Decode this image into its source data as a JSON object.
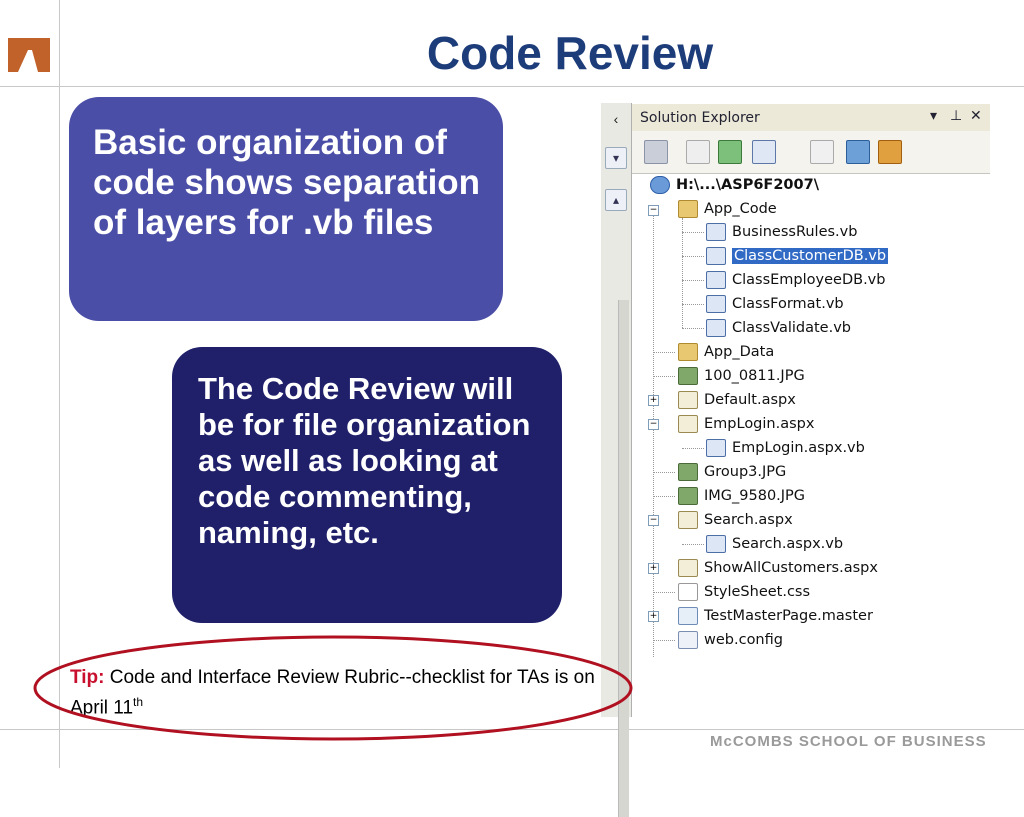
{
  "slide": {
    "title": "Code Review",
    "box1_text": "Basic organization of code shows separation of layers for .vb files",
    "box2_text": "The Code Review will be for file organization as well as looking at code commenting, naming, etc.",
    "tip_label": "Tip:",
    "tip_text": " Code and Interface Review Rubric--checklist for TAs is on April 11",
    "tip_sup": "th",
    "footer": "McCOMBS SCHOOL OF BUSINESS"
  },
  "solution_explorer": {
    "title": "Solution Explorer",
    "controls": [
      "▾",
      "⊥",
      "✕"
    ],
    "root": "H:\\...\\ASP6F2007\\",
    "items": [
      {
        "label": "App_Code",
        "icon": "folder-open-icon"
      },
      {
        "label": "BusinessRules.vb",
        "icon": "vb-file-icon"
      },
      {
        "label": "ClassCustomerDB.vb",
        "icon": "vb-file-icon"
      },
      {
        "label": "ClassEmployeeDB.vb",
        "icon": "vb-file-icon"
      },
      {
        "label": "ClassFormat.vb",
        "icon": "vb-file-icon"
      },
      {
        "label": "ClassValidate.vb",
        "icon": "vb-file-icon"
      },
      {
        "label": "App_Data",
        "icon": "folder-icon"
      },
      {
        "label": "100_0811.JPG",
        "icon": "image-file-icon"
      },
      {
        "label": "Default.aspx",
        "icon": "aspx-file-icon"
      },
      {
        "label": "EmpLogin.aspx",
        "icon": "aspx-file-icon"
      },
      {
        "label": "EmpLogin.aspx.vb",
        "icon": "vb-code-file-icon"
      },
      {
        "label": "Group3.JPG",
        "icon": "image-file-icon"
      },
      {
        "label": "IMG_9580.JPG",
        "icon": "image-file-icon"
      },
      {
        "label": "Search.aspx",
        "icon": "aspx-file-icon"
      },
      {
        "label": "Search.aspx.vb",
        "icon": "vb-code-file-icon"
      },
      {
        "label": "ShowAllCustomers.aspx",
        "icon": "aspx-file-icon"
      },
      {
        "label": "StyleSheet.css",
        "icon": "css-file-icon"
      },
      {
        "label": "TestMasterPage.master",
        "icon": "master-file-icon"
      },
      {
        "label": "web.config",
        "icon": "config-file-icon"
      }
    ],
    "selected": "ClassCustomerDB.vb"
  },
  "colors": {
    "title": "#1d3c7a",
    "box1": "#4a4ea6",
    "box2": "#1f1f6a",
    "tip_label": "#c8102e",
    "ellipse": "#b01020",
    "selection": "#316ac5"
  }
}
